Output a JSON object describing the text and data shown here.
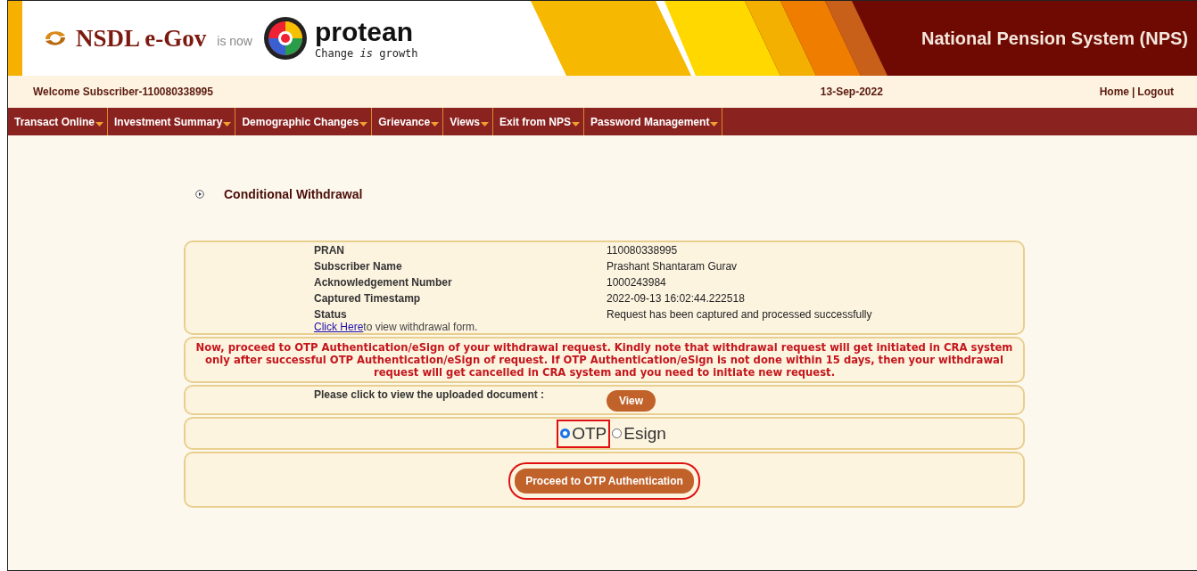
{
  "banner": {
    "brand": "NSDL e-Gov",
    "is_now": "is now",
    "protean": "protean",
    "tagline": "Change *is* growth",
    "title": "National Pension System (NPS)"
  },
  "welcome": "Welcome Subscriber-110080338995",
  "date": "13-Sep-2022",
  "top_links": [
    "Home",
    "|",
    "Logout"
  ],
  "menu": [
    "Transact Online",
    "Investment Summary",
    "Demographic Changes",
    "Grievance",
    "Views",
    "Exit from NPS",
    "Password Management"
  ],
  "page_title": "Conditional Withdrawal",
  "details": [
    {
      "label": "PRAN",
      "value": "110080338995"
    },
    {
      "label": "Subscriber Name",
      "value": "Prashant Shantaram Gurav"
    },
    {
      "label": "Acknowledgement Number",
      "value": "1000243984"
    },
    {
      "label": "Captured Timestamp",
      "value": "2022-09-13 16:02:44.222518"
    },
    {
      "label": "Status",
      "value": "Request has been captured and processed successfully"
    }
  ],
  "form_link": {
    "link": "Click Here",
    "text": "to view withdrawal form."
  },
  "notice": "Now, proceed to OTP Authentication/eSign of your withdrawal request. Kindly note that withdrawal request will get initiated in CRA system only after successful OTP Authentication/eSign of request. If OTP Authentication/eSign is not done within 15 days, then your withdrawal request will get cancelled in CRA system and you need to initiate new request.",
  "document": {
    "label": "Please click to view the uploaded document :",
    "button": "View"
  },
  "auth_options": [
    {
      "label": "OTP",
      "selected": true,
      "highlighted": true
    },
    {
      "label": "Esign",
      "selected": false,
      "highlighted": false
    }
  ],
  "proceed": {
    "label": "Proceed to OTP Authentication",
    "highlighted": true
  }
}
